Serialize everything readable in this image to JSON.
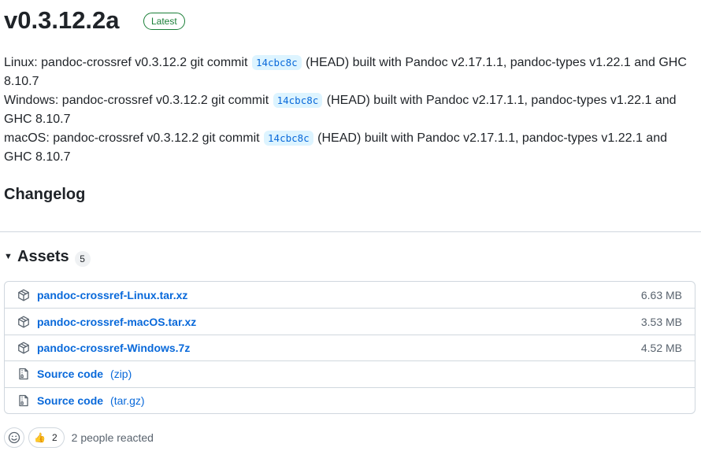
{
  "release": {
    "title": "v0.3.12.2a",
    "badge": "Latest",
    "notes": [
      {
        "prefix": "Linux: pandoc-crossref v0.3.12.2 git commit",
        "commit": "14cbc8c",
        "suffix": "(HEAD) built with Pandoc v2.17.1.1, pandoc-types v1.22.1 and GHC 8.10.7"
      },
      {
        "prefix": "Windows: pandoc-crossref v0.3.12.2 git commit",
        "commit": "14cbc8c",
        "suffix": "(HEAD) built with Pandoc v2.17.1.1, pandoc-types v1.22.1 and GHC 8.10.7"
      },
      {
        "prefix": "macOS: pandoc-crossref v0.3.12.2 git commit",
        "commit": "14cbc8c",
        "suffix": "(HEAD) built with Pandoc v2.17.1.1, pandoc-types v1.22.1 and GHC 8.10.7"
      }
    ],
    "changelog_heading": "Changelog"
  },
  "assets": {
    "title": "Assets",
    "count": "5",
    "items": [
      {
        "name": "pandoc-crossref-Linux.tar.xz",
        "size": "6.63 MB",
        "icon": "package-icon"
      },
      {
        "name": "pandoc-crossref-macOS.tar.xz",
        "size": "3.53 MB",
        "icon": "package-icon"
      },
      {
        "name": "pandoc-crossref-Windows.7z",
        "size": "4.52 MB",
        "icon": "package-icon"
      },
      {
        "name": "Source code",
        "type": "(zip)",
        "icon": "file-zip-icon"
      },
      {
        "name": "Source code",
        "type": "(tar.gz)",
        "icon": "file-zip-icon"
      }
    ]
  },
  "reactions": {
    "picker_icon": "smiley-icon",
    "items": [
      {
        "emoji": "👍",
        "count": "2"
      }
    ],
    "summary": "2 people reacted"
  },
  "colors": {
    "accent": "#0969da",
    "latest": "#1a7f37",
    "muted": "#59636e",
    "border": "#d0d7de"
  }
}
